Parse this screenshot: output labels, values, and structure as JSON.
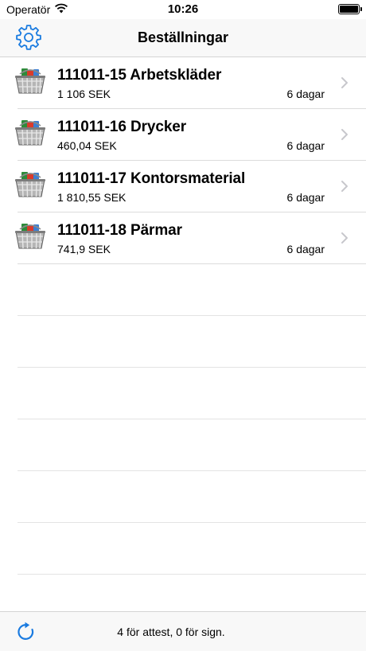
{
  "status_bar": {
    "carrier": "Operatör",
    "time": "10:26"
  },
  "nav": {
    "title": "Beställningar"
  },
  "orders": [
    {
      "title": "111011-15 Arbetskläder",
      "amount": "1 106 SEK",
      "age": "6 dagar"
    },
    {
      "title": "111011-16 Drycker",
      "amount": "460,04 SEK",
      "age": "6 dagar"
    },
    {
      "title": "111011-17 Kontorsmaterial",
      "amount": "1 810,55 SEK",
      "age": "6 dagar"
    },
    {
      "title": "111011-18 Pärmar",
      "amount": "741,9 SEK",
      "age": "6 dagar"
    }
  ],
  "toolbar": {
    "status": "4 för attest, 0 för sign."
  },
  "colors": {
    "accent": "#1a7be0",
    "chevron": "#c7c7cc",
    "separator": "#dcdcdc"
  },
  "icons": {
    "settings": "gear-icon",
    "refresh": "refresh-icon",
    "row": "shopping-basket-icon",
    "disclosure": "chevron-right-icon"
  }
}
